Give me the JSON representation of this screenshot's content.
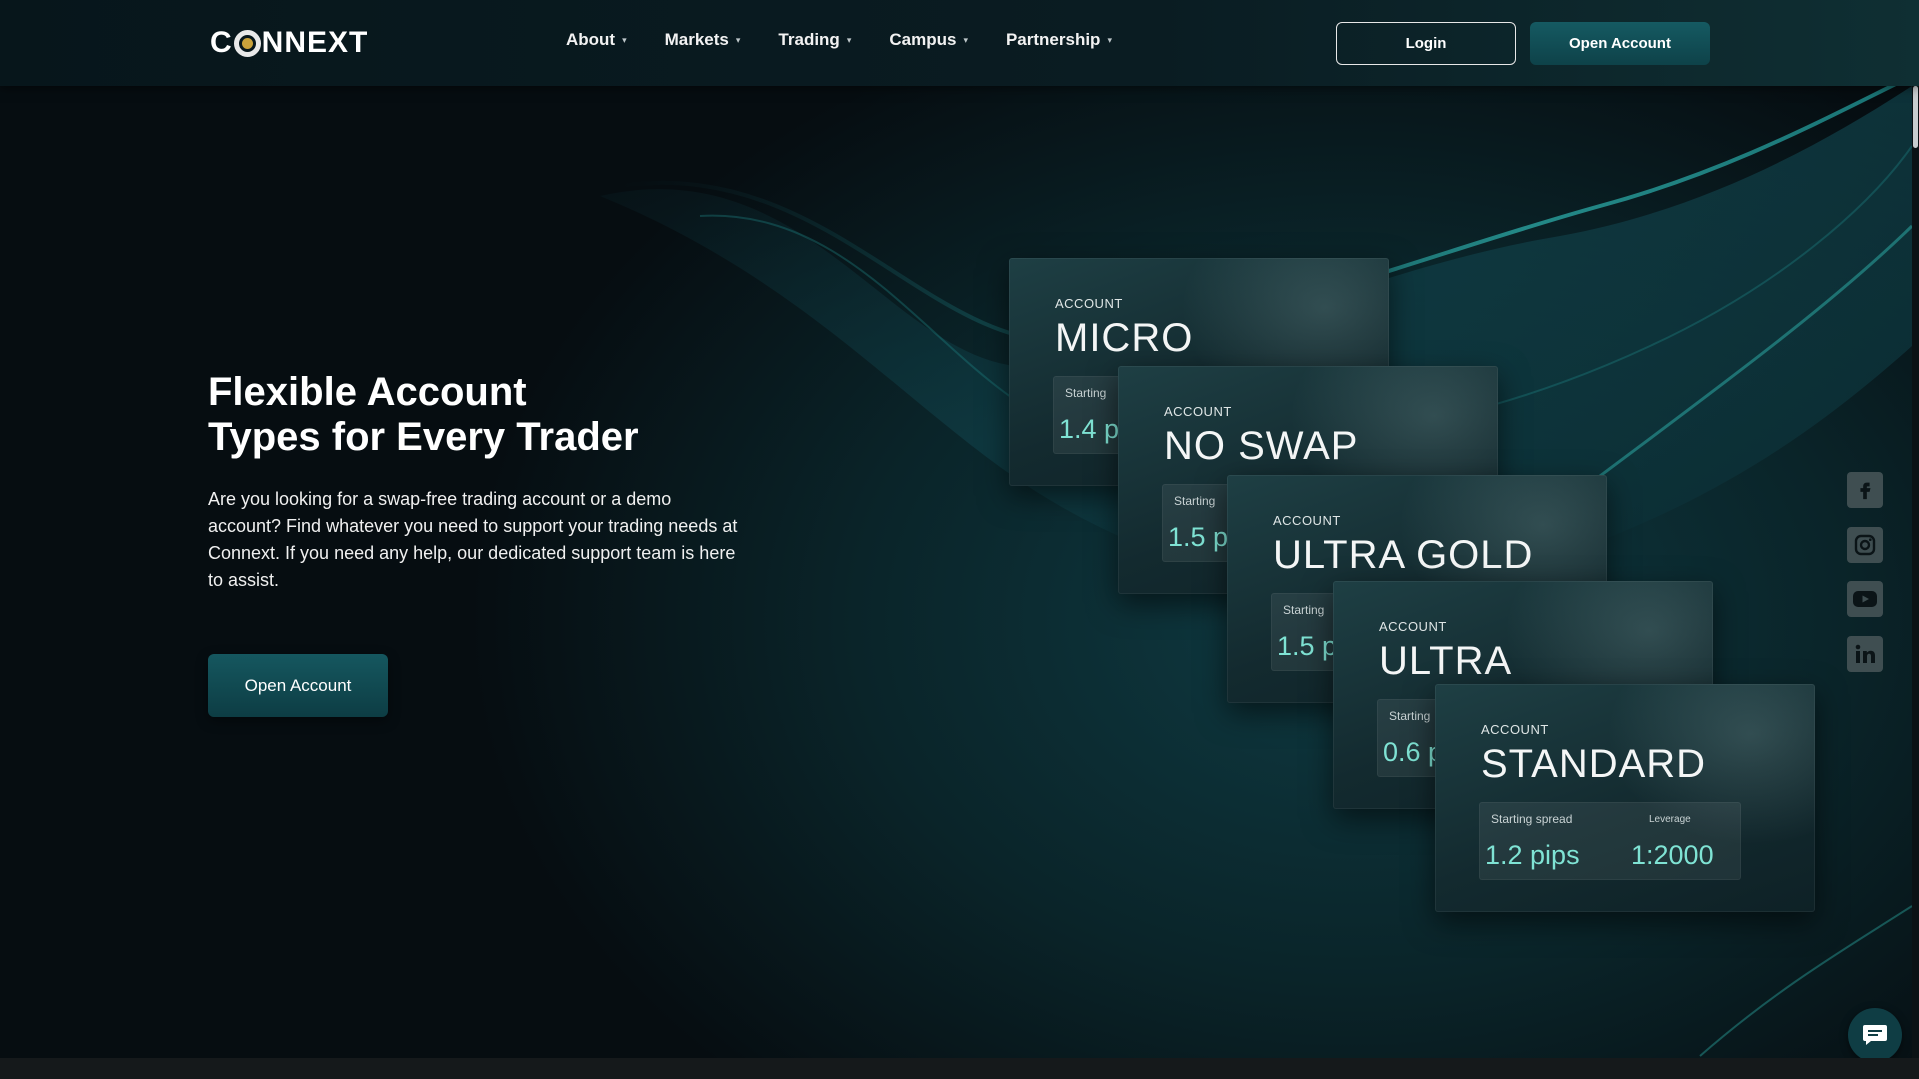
{
  "header": {
    "logo_left": "C",
    "logo_right": "NNEXT",
    "nav": [
      {
        "label": "About"
      },
      {
        "label": "Markets"
      },
      {
        "label": "Trading"
      },
      {
        "label": "Campus"
      },
      {
        "label": "Partnership"
      }
    ],
    "login_label": "Login",
    "open_account_label": "Open Account"
  },
  "hero": {
    "title_line1": "Flexible Account",
    "title_line2": "Types for Every Trader",
    "description": "Are you looking for a swap-free trading account or a demo account? Find whatever you need to support your trading needs at Connext. If you need any help, our dedicated support team is here to assist.",
    "cta_label": "Open Account"
  },
  "cards": [
    {
      "kicker": "ACCOUNT",
      "name": "MICRO",
      "label": "Starting",
      "value": "1.4 p"
    },
    {
      "kicker": "ACCOUNT",
      "name": "NO SWAP",
      "label": "Starting",
      "value": "1.5 p"
    },
    {
      "kicker": "ACCOUNT",
      "name": "ULTRA GOLD",
      "label": "Starting",
      "value": "1.5 p"
    },
    {
      "kicker": "ACCOUNT",
      "name": "ULTRA",
      "label": "Starting",
      "value": "0.6 p"
    },
    {
      "kicker": "ACCOUNT",
      "name": "STANDARD",
      "label": "Starting spread",
      "value": "1.2 pips",
      "label2": "Leverage",
      "value2": "1:2000"
    }
  ],
  "social": [
    {
      "icon": "facebook-icon",
      "glyph": "f"
    },
    {
      "icon": "instagram-icon",
      "glyph": ""
    },
    {
      "icon": "youtube-icon",
      "glyph": ""
    },
    {
      "icon": "linkedin-icon",
      "glyph": "in"
    }
  ],
  "colors": {
    "accent": "#0f4a52",
    "value_text": "#7fe3d4",
    "background": "#050a0d"
  }
}
